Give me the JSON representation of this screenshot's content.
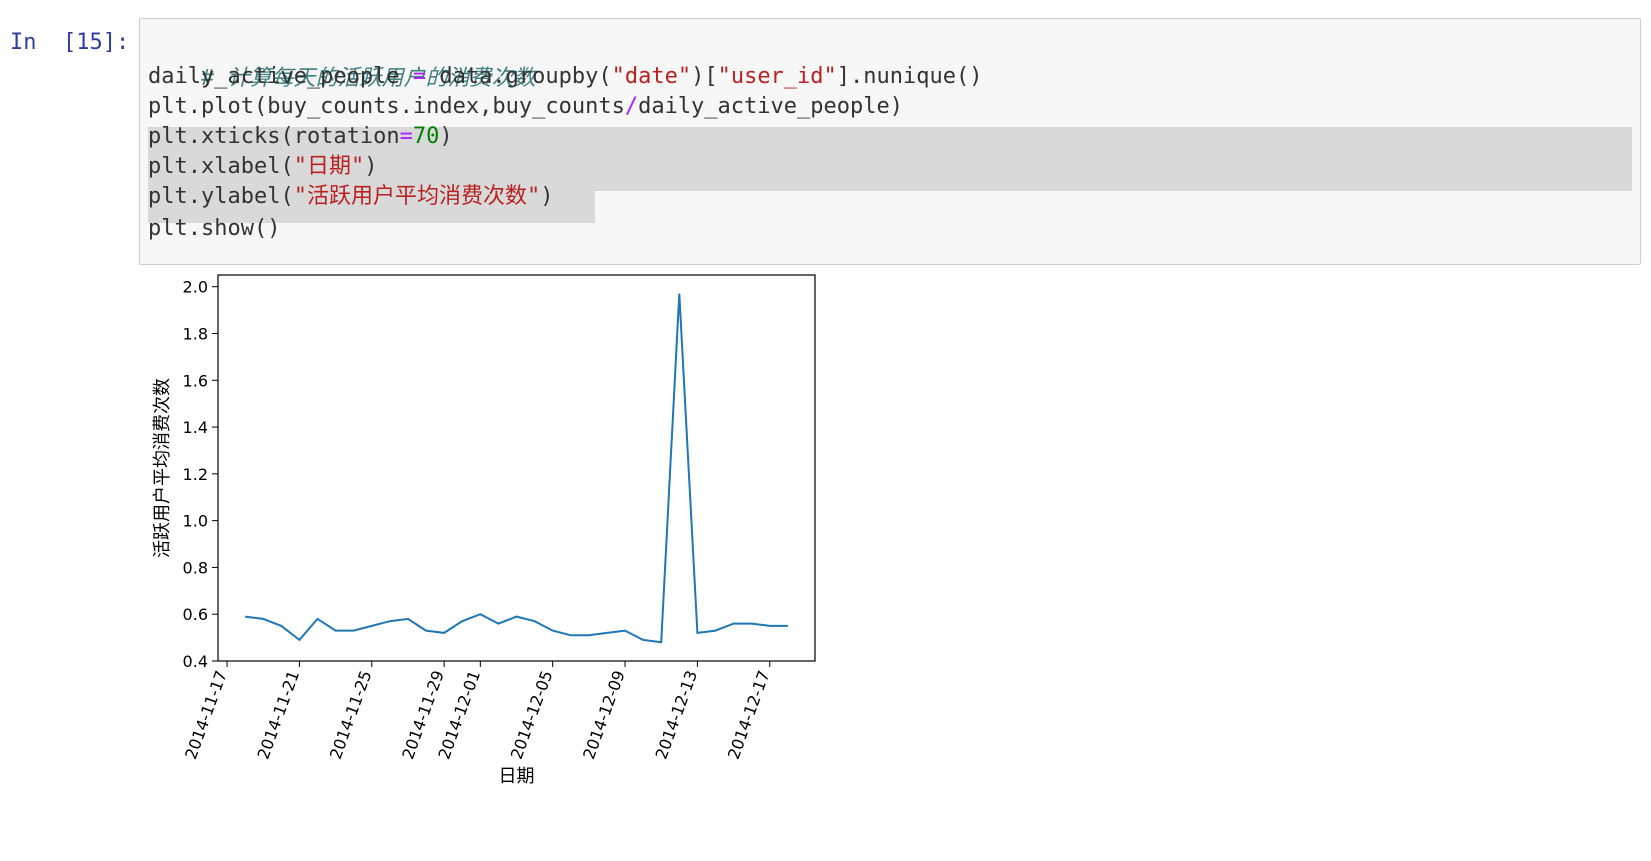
{
  "cell": {
    "prompt": "In  [15]:",
    "code": {
      "comment": "# 计算每天的活跃用户的消费次数",
      "l2_var": "daily_active_people ",
      "l2_eq": "=",
      "l2_call": " data.groupby(",
      "l2_str1": "\"date\"",
      "l2_mid": ")[",
      "l2_str2": "\"user_id\"",
      "l2_end": "].nunique()",
      "l3_a": "plt.plot(buy_counts.index,buy_counts",
      "l3_op": "/",
      "l3_b": "daily_active_people)",
      "l4_a": "plt.xticks(rotation",
      "l4_op": "=",
      "l4_num": "70",
      "l4_end": ")",
      "l5_a": "plt.xlabel(",
      "l5_str": "\"日期\"",
      "l5_end": ")",
      "l6_a": "plt.ylabel(",
      "l6_str": "\"活跃用户平均消费次数\"",
      "l6_end": ")",
      "l7": "plt.show()"
    }
  },
  "chart_data": {
    "type": "line",
    "title": "",
    "xlabel": "日期",
    "ylabel": "活跃用户平均消费次数",
    "ylim": [
      0.4,
      2.05
    ],
    "yticks": [
      "0.4",
      "0.6",
      "0.8",
      "1.0",
      "1.2",
      "1.4",
      "1.6",
      "1.8",
      "2.0"
    ],
    "xticks": [
      "2014-11-17",
      "2014-11-21",
      "2014-11-25",
      "2014-11-29",
      "2014-12-01",
      "2014-12-05",
      "2014-12-09",
      "2014-12-13",
      "2014-12-17"
    ],
    "x": [
      "2014-11-18",
      "2014-11-19",
      "2014-11-20",
      "2014-11-21",
      "2014-11-22",
      "2014-11-23",
      "2014-11-24",
      "2014-11-25",
      "2014-11-26",
      "2014-11-27",
      "2014-11-28",
      "2014-11-29",
      "2014-11-30",
      "2014-12-01",
      "2014-12-02",
      "2014-12-03",
      "2014-12-04",
      "2014-12-05",
      "2014-12-06",
      "2014-12-07",
      "2014-12-08",
      "2014-12-09",
      "2014-12-10",
      "2014-12-11",
      "2014-12-12",
      "2014-12-13",
      "2014-12-14",
      "2014-12-15",
      "2014-12-16",
      "2014-12-17",
      "2014-12-18"
    ],
    "series": [
      {
        "values": [
          0.59,
          0.58,
          0.55,
          0.49,
          0.58,
          0.53,
          0.53,
          0.55,
          0.57,
          0.58,
          0.53,
          0.52,
          0.57,
          0.6,
          0.56,
          0.59,
          0.57,
          0.53,
          0.51,
          0.51,
          0.52,
          0.53,
          0.49,
          0.48,
          1.97,
          0.52,
          0.53,
          0.56,
          0.56,
          0.55,
          0.55
        ],
        "color": "#1f77b4"
      }
    ],
    "grid": false
  }
}
